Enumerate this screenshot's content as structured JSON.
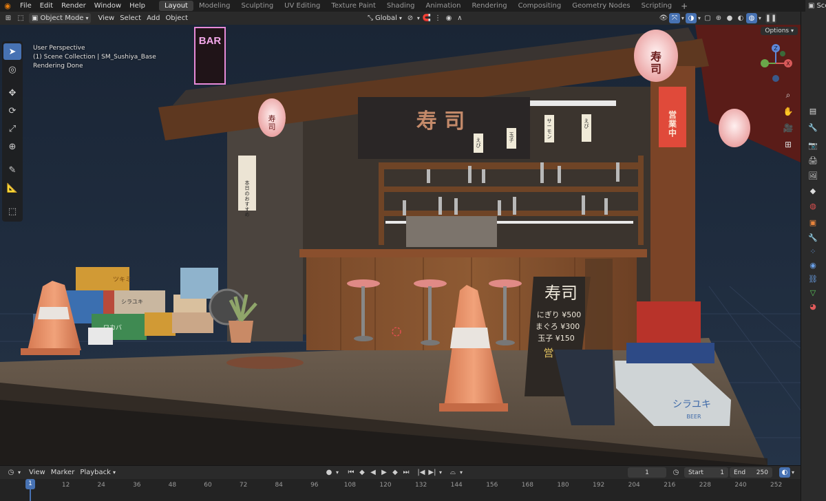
{
  "app": {
    "menu": [
      "File",
      "Edit",
      "Render",
      "Window",
      "Help"
    ],
    "workspaces": [
      "Layout",
      "Modeling",
      "Sculpting",
      "UV Editing",
      "Texture Paint",
      "Shading",
      "Animation",
      "Rendering",
      "Compositing",
      "Geometry Nodes",
      "Scripting"
    ],
    "active_workspace": "Layout",
    "add_workspace": "+",
    "scene_label": "Scen"
  },
  "viewport_header": {
    "mode": "Object Mode",
    "menus": [
      "View",
      "Select",
      "Add",
      "Object"
    ],
    "transform_orientation": "Global",
    "options_label": "Options"
  },
  "viewport": {
    "info_lines": [
      "User Perspective",
      "(1) Scene Collection | SM_Sushiya_Base",
      "Rendering Done"
    ],
    "gizmo_axes": [
      "Z",
      "X"
    ],
    "scene_text": {
      "neon_sign": "BAR",
      "lantern_large": "寿\n司",
      "lantern_small": "寿\n司",
      "noren": "寿 司",
      "open_sign": "営\n業\n中",
      "menu_board": "本\n日\nの\nお\nす\nす\nめ",
      "shelf_labels": [
        "サ\nー\nモ\nン",
        "え\nび",
        "玉\n子",
        "え\nび"
      ],
      "board_title": "寿司",
      "board_items": [
        "にぎり ¥500",
        "まぐろ ¥300",
        "玉子 ¥150"
      ],
      "board_badge": "営",
      "crate_labels": [
        "ツキミ",
        "シラユキ",
        "ワカバ"
      ],
      "big_crate_label": "シラユキ",
      "big_crate_sub": "BEER"
    }
  },
  "timeline": {
    "menus": [
      "View",
      "Marker",
      "Playback"
    ],
    "current_frame": "1",
    "start_label": "Start",
    "start_value": "1",
    "end_label": "End",
    "end_value": "250",
    "ticks": [
      "1",
      "12",
      "24",
      "36",
      "48",
      "60",
      "72",
      "84",
      "96",
      "108",
      "120",
      "132",
      "144",
      "156",
      "168",
      "180",
      "192",
      "204",
      "216",
      "228",
      "240",
      "252"
    ]
  },
  "colors": {
    "accent": "#4772b3",
    "header_bg": "#2a2a2a",
    "lantern": "#f4c1c1",
    "sign_red": "#e04a3a"
  }
}
